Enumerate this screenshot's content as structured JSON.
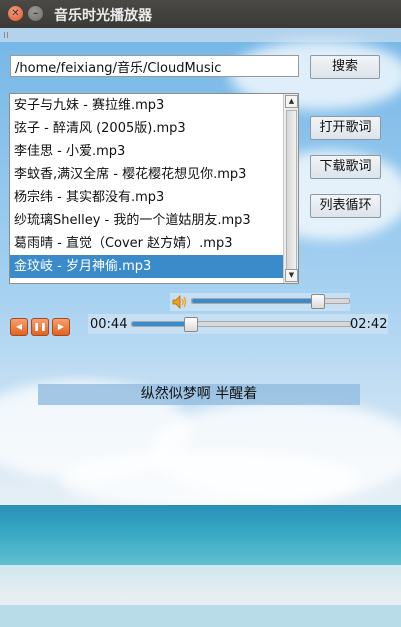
{
  "window": {
    "title": "音乐时光播放器"
  },
  "search": {
    "path_value": "/home/feixiang/音乐/CloudMusic",
    "button_label": "搜索"
  },
  "playlist": {
    "items": [
      "安子与九妹 - 赛拉维.mp3",
      "弦子 - 醉清风 (2005版).mp3",
      "李佳思 - 小爱.mp3",
      "李蚊香,满汉全席 - 樱花樱花想见你.mp3",
      "杨宗纬 - 其实都没有.mp3",
      "纱琉璃Shelley - 我的一个道姑朋友.mp3",
      "葛雨晴 - 直觉（Cover 赵方婧）.mp3",
      "金玟岐 - 岁月神偷.mp3"
    ],
    "selected_index": 7
  },
  "side_buttons": {
    "open_lyrics": "打开歌词",
    "download_lyrics": "下载歌词",
    "loop_mode": "列表循环"
  },
  "volume": {
    "level": 0.8,
    "icon": "speaker-icon"
  },
  "progress": {
    "current": "00:44",
    "total": "02:42",
    "fraction": 0.27
  },
  "transport": {
    "prev_icon": "previous-icon",
    "pause_icon": "pause-icon",
    "next_icon": "next-icon"
  },
  "lyric": {
    "line": "纵然似梦啊 半醒着"
  },
  "colors": {
    "accent": "#3b8bcb",
    "titlebar": "#3b3a36",
    "close": "#e05a2b",
    "transport": "#e2621f"
  }
}
